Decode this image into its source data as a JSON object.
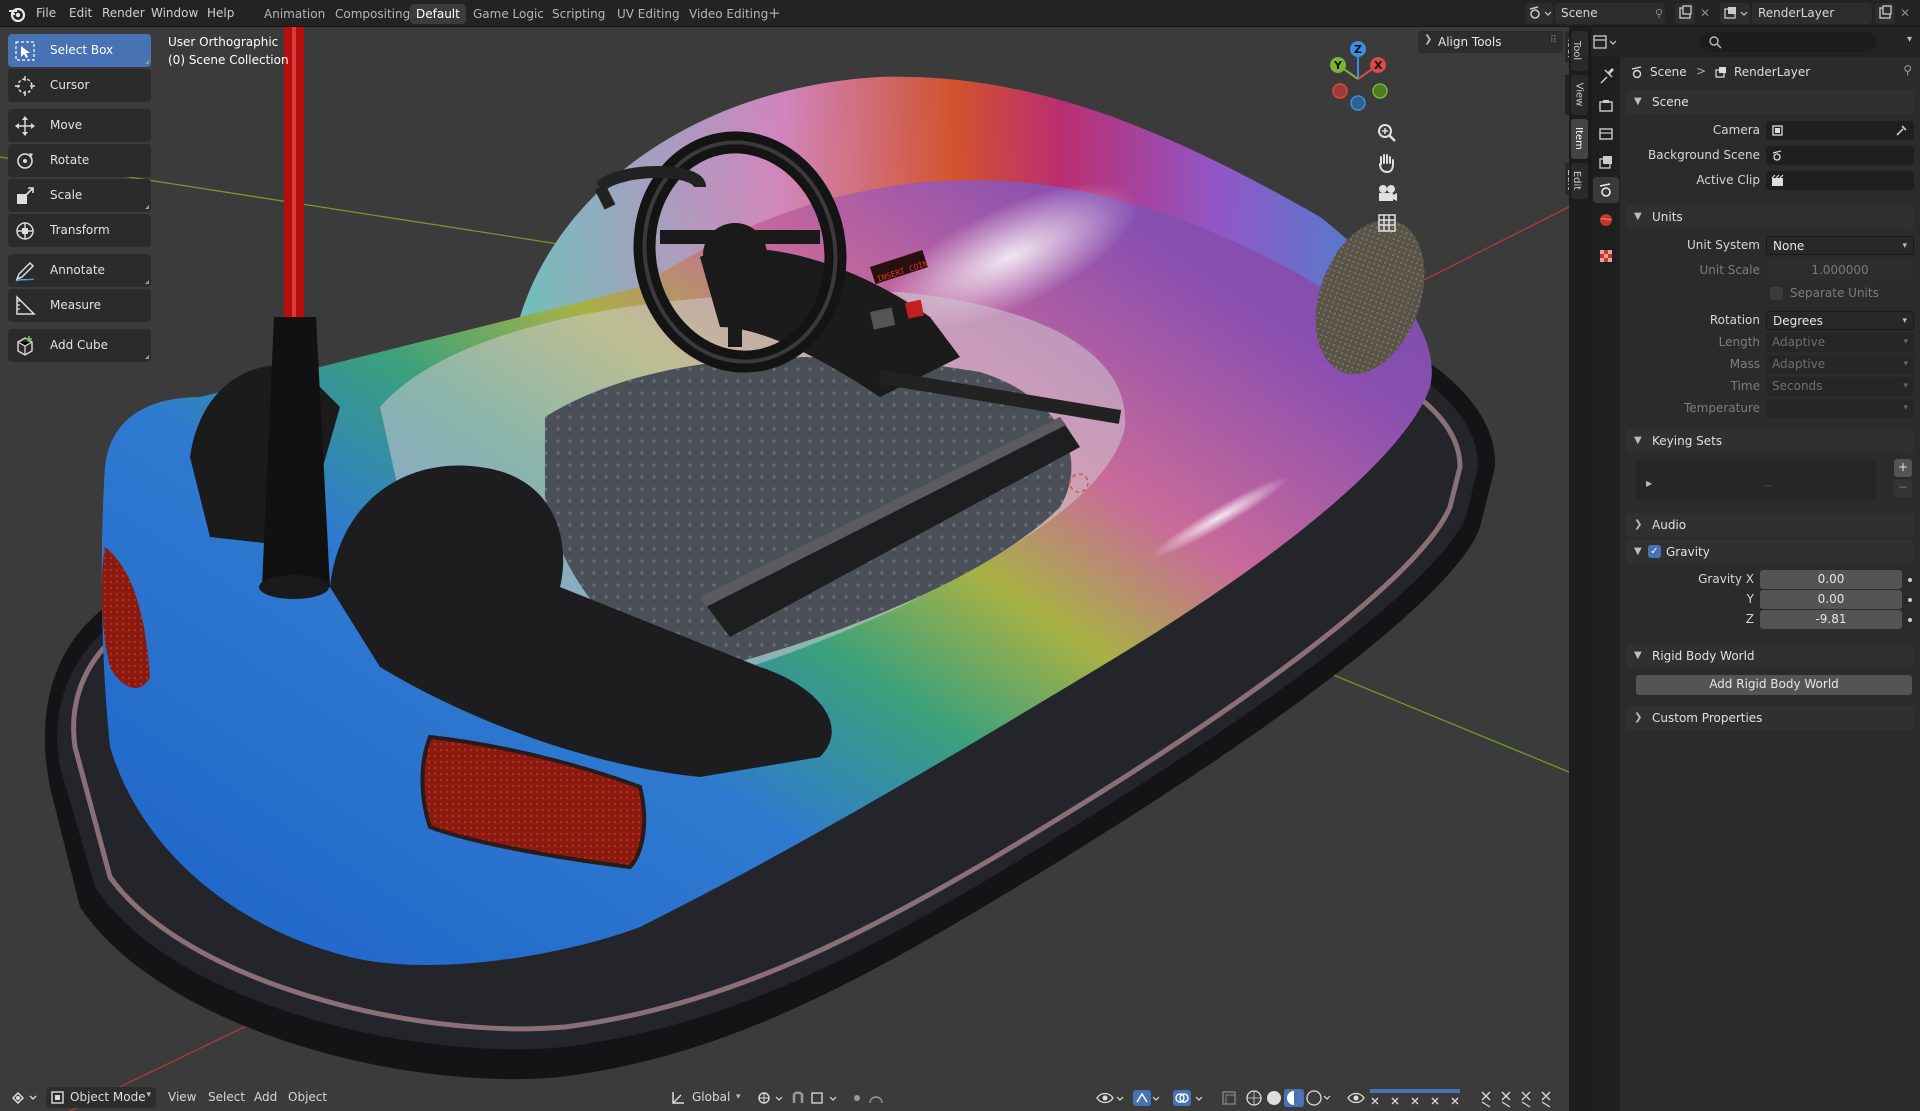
{
  "menu": {
    "items": [
      "File",
      "Edit",
      "Render",
      "Window",
      "Help"
    ],
    "workspaces": [
      "Animation",
      "Compositing",
      "Default",
      "Game Logic",
      "Scripting",
      "UV Editing",
      "Video Editing"
    ],
    "active_workspace": "Default",
    "add_tab": "+"
  },
  "scene_selector": {
    "value": "Scene"
  },
  "view_layer_selector": {
    "value": "RenderLayer"
  },
  "toolbar": {
    "tools": [
      {
        "label": "Select Box",
        "icon": "select-box-icon",
        "active": true
      },
      {
        "label": "Cursor",
        "icon": "cursor-icon",
        "active": false
      },
      {
        "label": "Move",
        "icon": "move-icon",
        "active": false
      },
      {
        "label": "Rotate",
        "icon": "rotate-icon",
        "active": false
      },
      {
        "label": "Scale",
        "icon": "scale-icon",
        "active": false
      },
      {
        "label": "Transform",
        "icon": "transform-icon",
        "active": false
      },
      {
        "label": "Annotate",
        "icon": "annotate-icon",
        "active": false
      },
      {
        "label": "Measure",
        "icon": "measure-icon",
        "active": false
      },
      {
        "label": "Add Cube",
        "icon": "add-cube-icon",
        "active": false
      }
    ]
  },
  "viewport": {
    "view_name": "User Orthographic",
    "collection": "(0) Scene Collection",
    "align_tools": "Align Tools",
    "side_tabs": [
      "Tool",
      "View",
      "Item",
      "Edit"
    ],
    "gizmo": {
      "x": "X",
      "y": "Y",
      "z": "Z"
    },
    "dashboard_text": "INSERT COIN"
  },
  "viewport_header": {
    "mode": "Object Mode",
    "menus": [
      "View",
      "Select",
      "Add",
      "Object"
    ],
    "orientation": "Global"
  },
  "properties": {
    "breadcrumb": {
      "scene": "Scene",
      "separator": ">",
      "layer": "RenderLayer"
    },
    "scene_panel": {
      "title": "Scene",
      "camera_label": "Camera",
      "camera_value": "",
      "background_label": "Background Scene",
      "background_value": "",
      "clip_label": "Active Clip",
      "clip_value": ""
    },
    "units_panel": {
      "title": "Units",
      "unit_system_label": "Unit System",
      "unit_system_value": "None",
      "unit_scale_label": "Unit Scale",
      "unit_scale_value": "1.000000",
      "separate_units_label": "Separate Units",
      "rotation_label": "Rotation",
      "rotation_value": "Degrees",
      "length_label": "Length",
      "length_value": "Adaptive",
      "mass_label": "Mass",
      "mass_value": "Adaptive",
      "time_label": "Time",
      "time_value": "Seconds",
      "temperature_label": "Temperature",
      "temperature_value": ""
    },
    "keying_sets_panel": {
      "title": "Keying Sets",
      "add": "+",
      "remove": "−"
    },
    "audio_panel": {
      "title": "Audio"
    },
    "gravity_panel": {
      "title": "Gravity",
      "enabled": true,
      "x_label": "Gravity X",
      "x_value": "0.00",
      "y_label": "Y",
      "y_value": "0.00",
      "z_label": "Z",
      "z_value": "-9.81"
    },
    "rigid_body_panel": {
      "title": "Rigid Body World",
      "button": "Add Rigid Body World"
    },
    "custom_properties_panel": {
      "title": "Custom Properties"
    }
  },
  "colors": {
    "accent": "#4772b3",
    "header_bg": "#232323",
    "panel_bg": "#2b2b2b",
    "viewport_bg": "#3b3b3b",
    "axis_x": "#d94a4a",
    "axis_y": "#7bb33a",
    "axis_z": "#3d8ee0"
  }
}
